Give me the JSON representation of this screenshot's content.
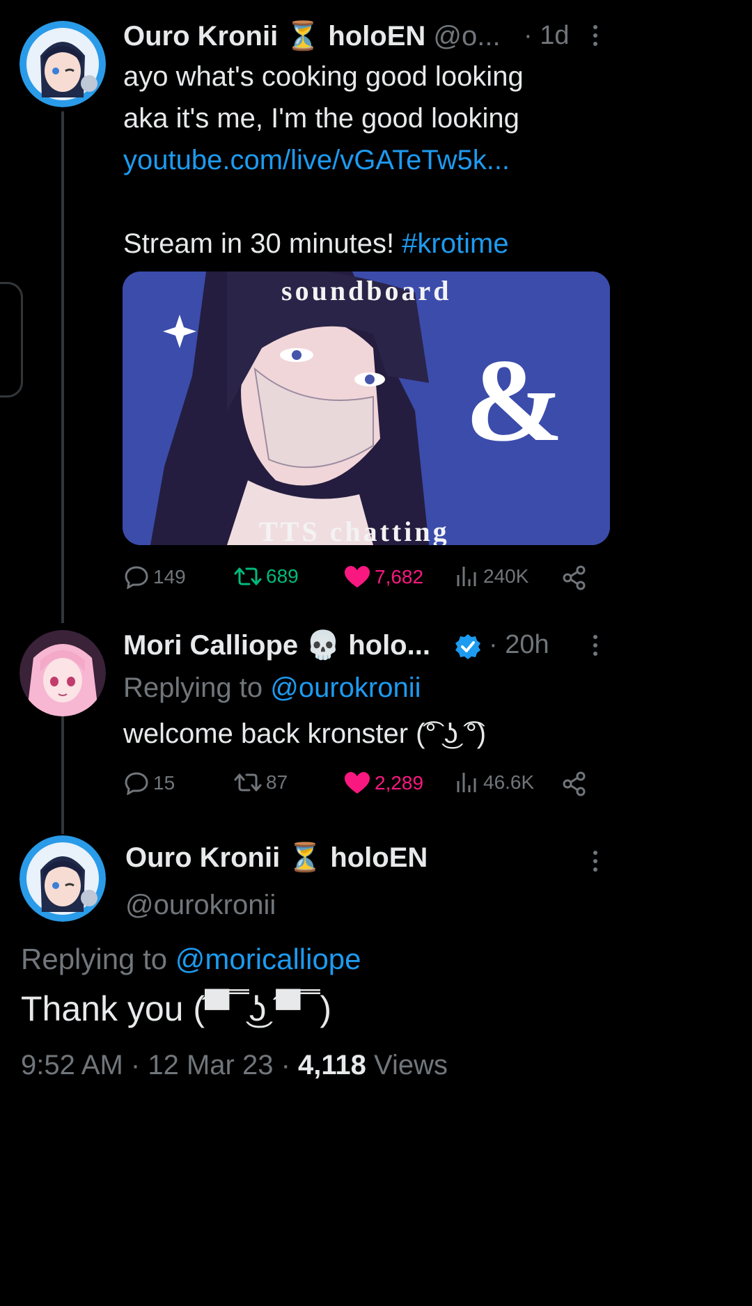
{
  "colors": {
    "background": "#000000",
    "text": "#e7e9ea",
    "muted": "#71767b",
    "link": "#1d9bf0",
    "retweet": "#00ba7c",
    "like": "#f91880",
    "verified": "#1d9bf0"
  },
  "tweet1": {
    "name": "Ouro Kronii",
    "emoji": "⏳",
    "name_suffix": "holoEN",
    "handle": "@o...",
    "time": "· 1d",
    "line1": "ayo what's cooking good looking",
    "line2": "aka it's me, I'm the good looking",
    "link": "youtube.com/live/vGATeTw5k...",
    "line4_text": "Stream in 30 minutes!",
    "hashtag": "#krotime",
    "media": {
      "top_text": "soundboard",
      "amp": "&",
      "bottom_text": "TTS chatting"
    },
    "stats": {
      "replies": "149",
      "retweets": "689",
      "likes": "7,682",
      "views": "240K"
    }
  },
  "tweet2": {
    "name": "Mori Calliope",
    "emoji": "💀",
    "name_suffix": "holo...",
    "time": "· 20h",
    "replying_prefix": "Replying to",
    "replying_handle": "@ourokronii",
    "text": "welcome back kronster (͡° ͜ʖ ͡°)",
    "stats": {
      "replies": "15",
      "retweets": "87",
      "likes": "2,289",
      "views": "46.6K"
    }
  },
  "tweet3": {
    "name": "Ouro Kronii",
    "emoji": "⏳",
    "name_suffix": "holoEN",
    "handle": "@ourokronii",
    "replying_prefix": "Replying to",
    "replying_handle": "@moricalliope",
    "text": "Thank you (͡▀̿ ̿ ͜ʖ ͡▀̿ ̿ )",
    "time": "9:52 AM",
    "date": "12 Mar 23",
    "views_count": "4,118",
    "views_label": "Views"
  }
}
